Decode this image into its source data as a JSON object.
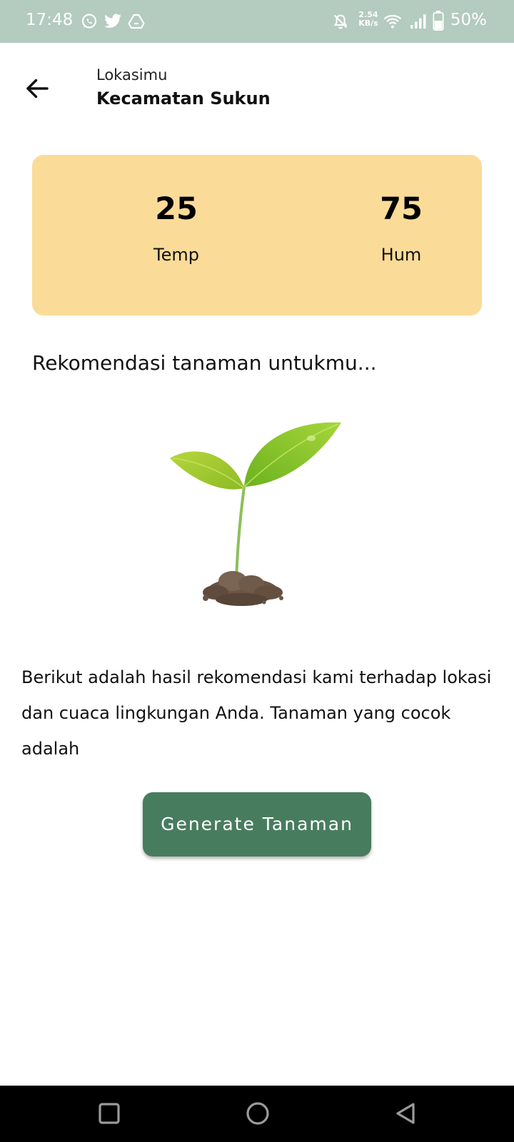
{
  "status_bar": {
    "time": "17:48",
    "battery_percent": "50%",
    "net_speed_value": "2.54",
    "net_speed_unit": "KB/s",
    "notification_icons": [
      "whatsapp-icon",
      "twitter-icon",
      "drive-icon"
    ],
    "system_icons": [
      "bell-off-icon",
      "wifi-icon",
      "signal-icon",
      "battery-icon"
    ],
    "background_color": "#b4cbbf"
  },
  "header": {
    "location_label": "Lokasimu",
    "location_name": "Kecamatan Sukun",
    "back_icon": "arrow-left-icon"
  },
  "weather": {
    "card_color": "#fbdb98",
    "temp_value": "25",
    "temp_label": "Temp",
    "hum_value": "75",
    "hum_label": "Hum"
  },
  "recommendation": {
    "title": "Rekomendasi tanaman untukmu...",
    "illustration": "sprout-illustration",
    "description": "Berikut adalah hasil rekomendasi kami terhadap lokasi dan cuaca lingkungan Anda. Tanaman yang cocok adalah"
  },
  "actions": {
    "generate_label": "Generate Tanaman",
    "button_color": "#487c5e"
  },
  "nav_bar": {
    "buttons": [
      "recents-square-icon",
      "home-circle-icon",
      "back-triangle-icon"
    ]
  }
}
